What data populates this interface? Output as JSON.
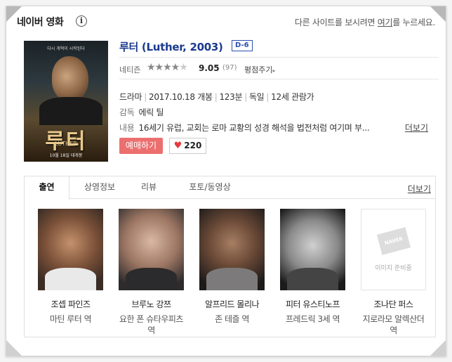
{
  "header": {
    "brand": "네이버 영화",
    "info_icon": "i",
    "redirect_prefix": "다른 사이트를 보시려면 ",
    "redirect_link": "여기",
    "redirect_suffix": "를 누르세요."
  },
  "poster": {
    "top_text": "다시 개혁이 시작된다",
    "title": "루터",
    "subtitle": "LUTHER",
    "date_text": "10월 18일 대개봉"
  },
  "movie": {
    "title": "루터 (Luther, 2003)",
    "rating_badge": "D-6",
    "score_label": "네티즌",
    "stars": "★★★★",
    "half_star": "★",
    "score": "9.05",
    "score_count": "(97)",
    "rate_link": "평점주기",
    "genre": "드라마",
    "release": "2017.10.18 개봉",
    "runtime": "123분",
    "country": "독일",
    "age": "12세 관람가",
    "director_label": "감독",
    "director": "에릭 틸",
    "content_label": "내용",
    "content": "16세기 유럽, 교회는 로마 교황의 성경 해석을 법전처럼 여기며 부...",
    "more_link": "더보기",
    "reserve_button": "예매하기",
    "like_count": "220"
  },
  "tabs": {
    "items": [
      "출연",
      "상영정보",
      "리뷰",
      "포토/동영상"
    ],
    "more": "더보기"
  },
  "cast": [
    {
      "name": "조셉 파인즈",
      "role": "마틴 루터 역"
    },
    {
      "name": "브루노 강쯔",
      "role": "요한 폰 슈타우피츠 역"
    },
    {
      "name": "알프리드 몰리나",
      "role": "존 테즐 역"
    },
    {
      "name": "피터 유스티노프",
      "role": "프레드릭 3세 역"
    },
    {
      "name": "조나단 퍼스",
      "role": "지로라모 알렉산더 역"
    }
  ],
  "placeholder": {
    "logo_text": "NAVER",
    "label": "이미지 준비중"
  }
}
